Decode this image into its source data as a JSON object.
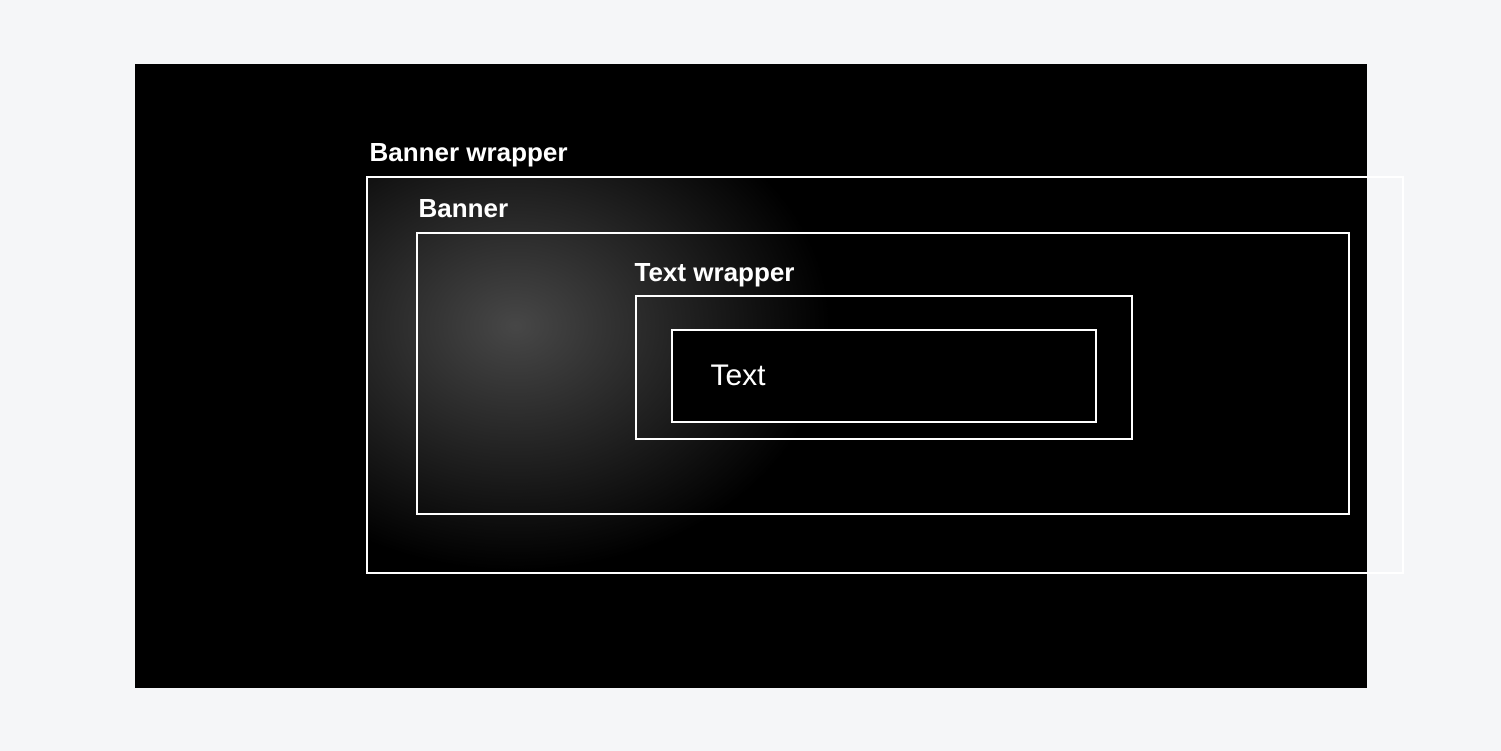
{
  "diagram": {
    "banner_wrapper_label": "Banner wrapper",
    "banner_label": "Banner",
    "text_wrapper_label": "Text wrapper",
    "text_label": "Text"
  }
}
